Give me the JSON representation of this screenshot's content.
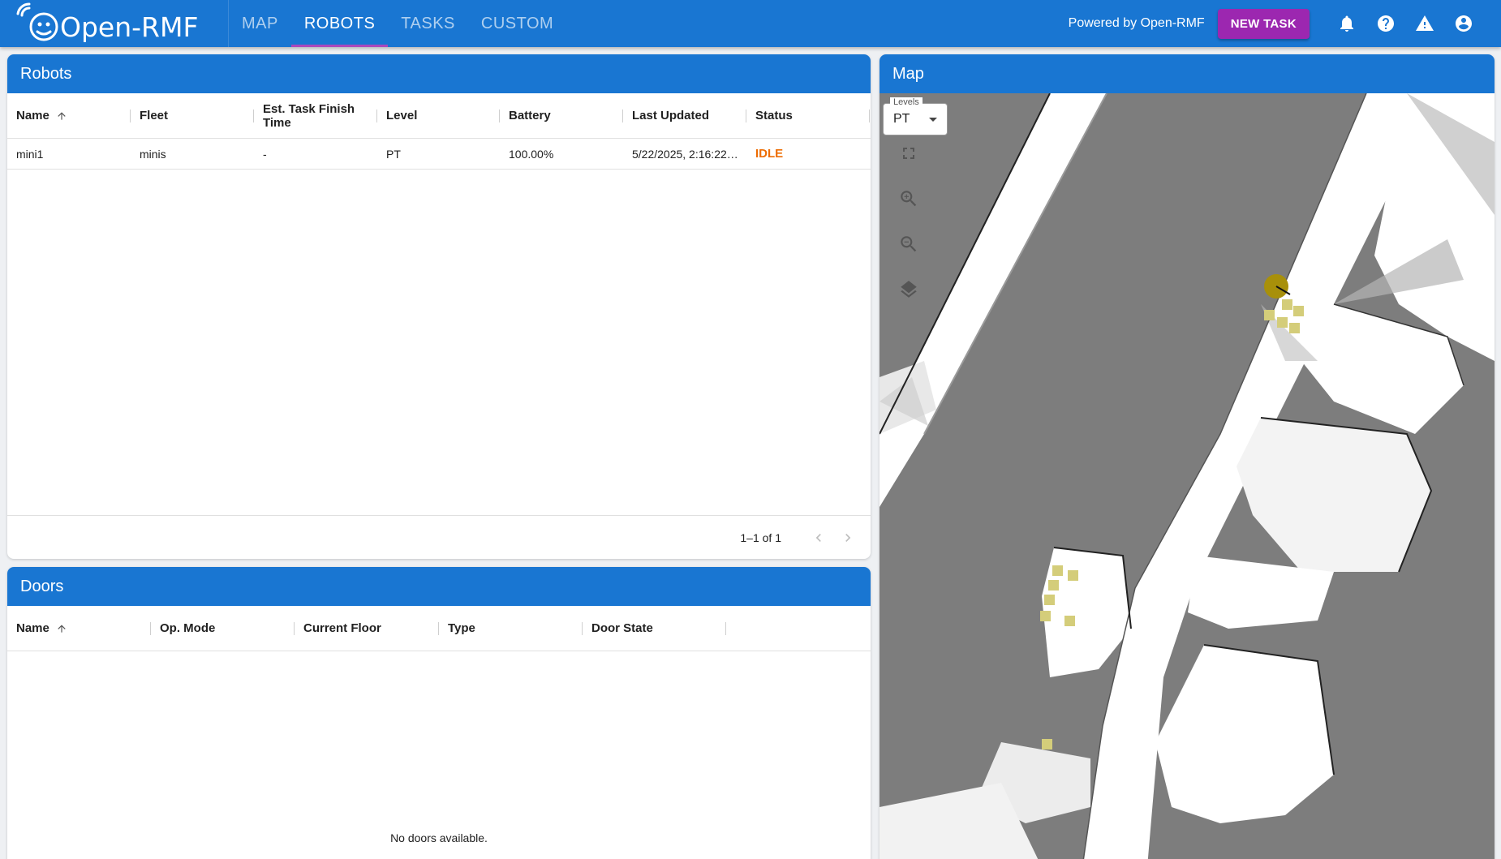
{
  "app": {
    "logo_text": "Open-RMF",
    "nav_tabs": [
      "MAP",
      "ROBOTS",
      "TASKS",
      "CUSTOM"
    ],
    "active_tab": "ROBOTS",
    "powered_by": "Powered by Open-RMF",
    "new_task_label": "NEW TASK",
    "icons": [
      "bell-icon",
      "help-icon",
      "warning-icon",
      "account-icon"
    ],
    "colors": {
      "primary": "#1976d2",
      "accent": "#9c27b0",
      "status_idle": "#ed6c02"
    }
  },
  "robots": {
    "title": "Robots",
    "columns": [
      "Name",
      "Fleet",
      "Est. Task Finish Time",
      "Level",
      "Battery",
      "Last Updated",
      "Status"
    ],
    "rows": [
      {
        "name": "mini1",
        "fleet": "minis",
        "est_finish": "-",
        "level": "PT",
        "battery": "100.00%",
        "last_updated": "5/22/2025, 2:16:22…",
        "status": "IDLE"
      }
    ],
    "pagination": "1–1 of 1"
  },
  "doors": {
    "title": "Doors",
    "columns": [
      "Name",
      "Op. Mode",
      "Current Floor",
      "Type",
      "Door State"
    ],
    "empty_message": "No doors available."
  },
  "map": {
    "title": "Map",
    "levels_label": "Levels",
    "level_value": "PT",
    "controls": [
      "fullscreen-icon",
      "zoom-in-icon",
      "zoom-out-icon",
      "layers-icon"
    ]
  }
}
